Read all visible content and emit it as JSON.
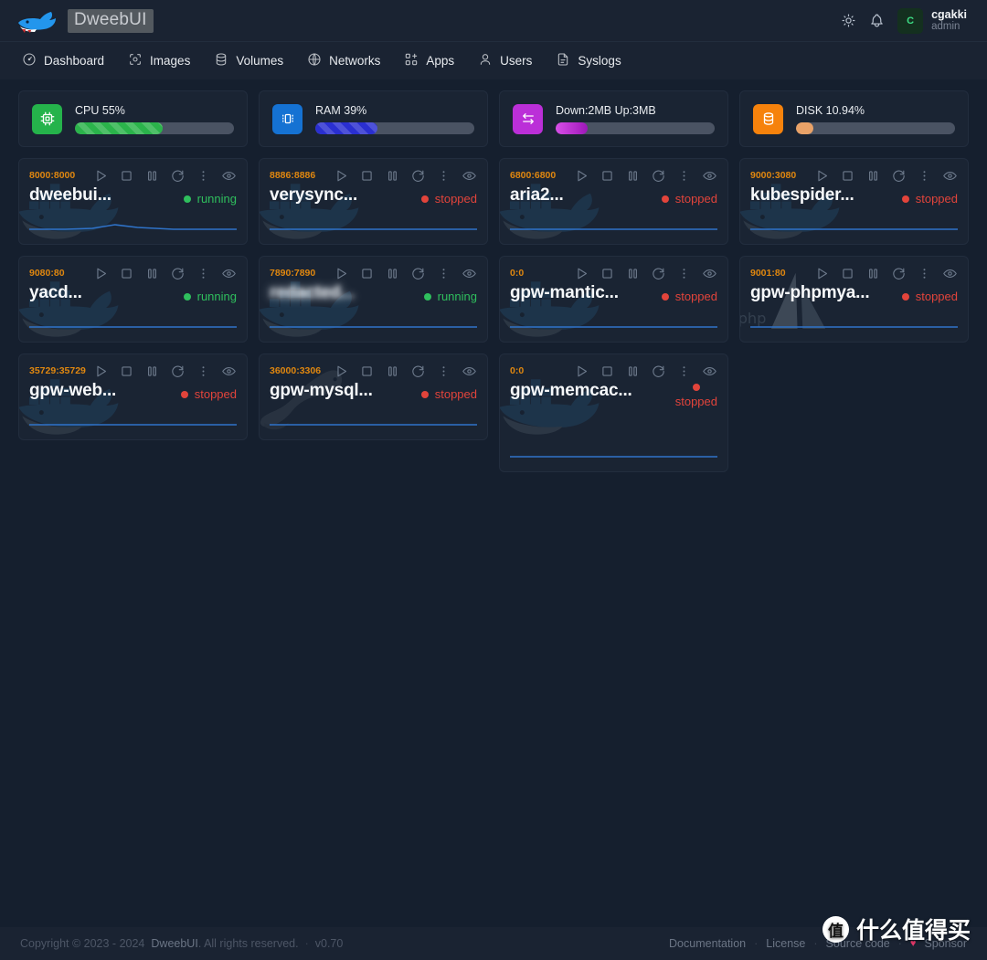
{
  "header": {
    "logo_icon": "docker-whale-icon",
    "title": "DweebUI",
    "theme_icon": "sun-icon",
    "bell_icon": "bell-icon",
    "avatar_initial": "C",
    "user_name": "cgakki",
    "user_role": "admin"
  },
  "nav": {
    "items": [
      {
        "label": "Dashboard",
        "icon": "gauge-icon"
      },
      {
        "label": "Images",
        "icon": "images-icon"
      },
      {
        "label": "Volumes",
        "icon": "database-icon"
      },
      {
        "label": "Networks",
        "icon": "globe-icon"
      },
      {
        "label": "Apps",
        "icon": "apps-grid-plus-icon"
      },
      {
        "label": "Users",
        "icon": "user-icon"
      },
      {
        "label": "Syslogs",
        "icon": "document-icon"
      }
    ]
  },
  "stats": [
    {
      "label": "CPU 55%",
      "icon": "cpu-chip-icon",
      "percent": 55,
      "color": "#2bb34b",
      "icon_bg": "#25b34b"
    },
    {
      "label": "RAM 39%",
      "icon": "memory-icon",
      "percent": 39,
      "color": "#2a2fd0",
      "icon_bg": "#1572d3"
    },
    {
      "label": "Down:2MB Up:3MB",
      "icon": "transfer-icon",
      "percent": 20,
      "color": "#b624cf",
      "icon_bg": "#bb2fd8"
    },
    {
      "label": "DISK 10.94%",
      "icon": "disk-icon",
      "percent": 10.94,
      "color": "#e9a268",
      "icon_bg": "#f6820c"
    }
  ],
  "stat_track_color": "#4a5363",
  "containers": [
    {
      "port": "8000:8000",
      "name": "dweebui...",
      "status": "running",
      "watermark": "docker-whale-icon",
      "tall": false,
      "blurred": false,
      "spark": "bump"
    },
    {
      "port": "8886:8886",
      "name": "verysync...",
      "status": "stopped",
      "watermark": "docker-whale-icon",
      "tall": false,
      "blurred": false,
      "spark": "flat"
    },
    {
      "port": "6800:6800",
      "name": "aria2...",
      "status": "stopped",
      "watermark": "docker-whale-icon",
      "tall": false,
      "blurred": false,
      "spark": "flat"
    },
    {
      "port": "9000:3080",
      "name": "kubespider...",
      "status": "stopped",
      "watermark": "docker-whale-icon",
      "tall": false,
      "blurred": false,
      "spark": "flat"
    },
    {
      "port": "9080:80",
      "name": "yacd...",
      "status": "running",
      "watermark": "docker-whale-icon",
      "tall": false,
      "blurred": false,
      "spark": "flat"
    },
    {
      "port": "7890:7890",
      "name": "redacted...",
      "status": "running",
      "watermark": "docker-whale-icon",
      "tall": false,
      "blurred": true,
      "spark": "flat"
    },
    {
      "port": "0:0",
      "name": "gpw-mantic...",
      "status": "stopped",
      "watermark": "docker-whale-icon",
      "tall": false,
      "blurred": false,
      "spark": "flat"
    },
    {
      "port": "9001:80",
      "name": "gpw-phpmya...",
      "status": "stopped",
      "watermark": "phpmyadmin-icon",
      "tall": false,
      "blurred": false,
      "spark": "flat"
    },
    {
      "port": "35729:35729",
      "name": "gpw-web...",
      "status": "stopped",
      "watermark": "docker-whale-icon",
      "tall": false,
      "blurred": false,
      "spark": "flat"
    },
    {
      "port": "36000:3306",
      "name": "gpw-mysql...",
      "status": "stopped",
      "watermark": "mysql-dolphin-icon",
      "tall": false,
      "blurred": false,
      "spark": "flat"
    },
    {
      "port": "0:0",
      "name": "gpw-memcac...",
      "status": "stopped",
      "watermark": "docker-whale-icon",
      "tall": true,
      "blurred": false,
      "spark": "flat"
    }
  ],
  "card_actions": [
    {
      "icon": "play-icon"
    },
    {
      "icon": "stop-icon"
    },
    {
      "icon": "pause-icon"
    },
    {
      "icon": "restart-icon"
    },
    {
      "icon": "kebab-menu-icon"
    },
    {
      "icon": "eye-icon"
    }
  ],
  "status_colors": {
    "running": "#2fbf5d",
    "stopped": "#e2443b"
  },
  "footer": {
    "copyright_prefix": "Copyright © 2023 - 2024",
    "brand": "DweebUI",
    "copyright_suffix": ". All rights reserved.",
    "separator": "·",
    "version": "v0.70",
    "links": [
      "Documentation",
      "License",
      "Source code",
      "Sponsor"
    ],
    "heart_icon": "heart-icon"
  },
  "watermark_overlay": {
    "badge": "值",
    "text": "什么值得买"
  }
}
